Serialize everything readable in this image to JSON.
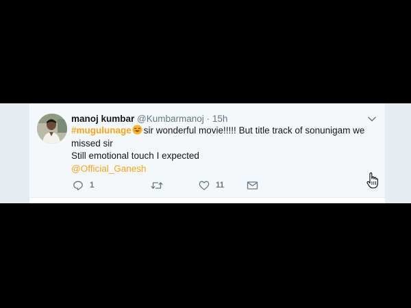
{
  "tweet": {
    "author_name": "manoj kumbar",
    "author_handle": "@Kumbarmanoj",
    "separator": "·",
    "timestamp": "15h",
    "hashtag": "#mugulunage",
    "emoji": "smiling-face-emoji",
    "text_line1": "sir wonderful movie!!!!! But title track of sonunigam we missed sir",
    "text_line2": "Still emotional touch I expected",
    "mention": "@Official_Ganesh",
    "actions": {
      "reply_count": "1",
      "retweet_count": "",
      "like_count": "11"
    },
    "icons": {
      "more": "chevron-down-icon",
      "reply": "reply-icon",
      "retweet": "retweet-icon",
      "like": "heart-icon",
      "dm": "envelope-icon",
      "cursor": "hand-pointer-cursor"
    }
  },
  "colors": {
    "background": "#000000",
    "card": "#f5f8fa",
    "link_accent": "#f5a623",
    "text": "#14171a",
    "muted": "#657786"
  }
}
